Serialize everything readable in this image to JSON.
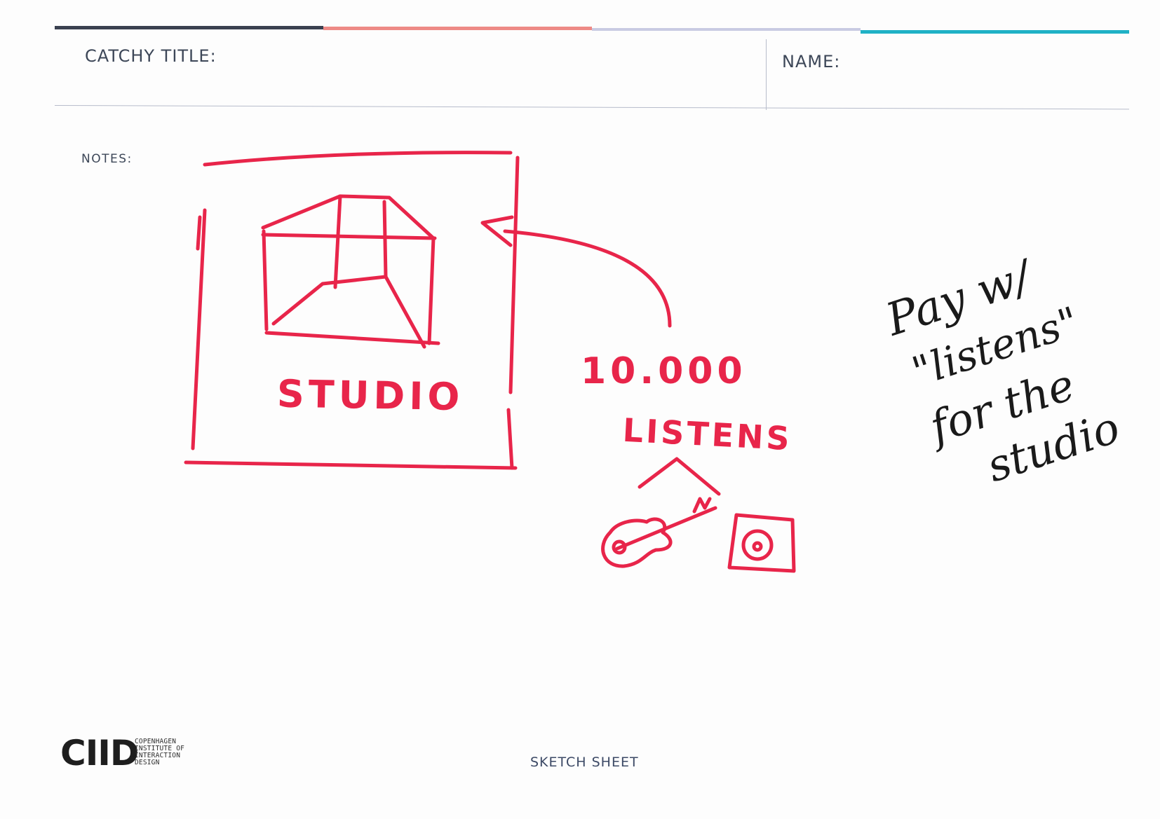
{
  "colors": {
    "bar_dark": "#3a4150",
    "bar_coral": "#ee8a86",
    "bar_lavender": "#c9cbe3",
    "bar_teal": "#1fb1c6",
    "sketch_red": "#e8254a",
    "pen_black": "#1a1a1a"
  },
  "header": {
    "title_label": "CATCHY TITLE:",
    "name_label": "NAME:"
  },
  "notes_label": "NOTES:",
  "sketch": {
    "box_label": "STUDIO",
    "count": "10.000",
    "count_label": "LISTENS",
    "icons": [
      "guitar-icon",
      "speaker-icon",
      "studio-room-icon",
      "arrow-icon"
    ]
  },
  "handwriting": {
    "lines": [
      "Pay w/",
      "\"listens\"",
      "for the",
      "studio"
    ]
  },
  "footer": {
    "logo_text": "CIID",
    "logo_subtext": "COPENHAGEN INSTITUTE OF INTERACTION DESIGN",
    "sheet_label": "SKETCH SHEET"
  }
}
